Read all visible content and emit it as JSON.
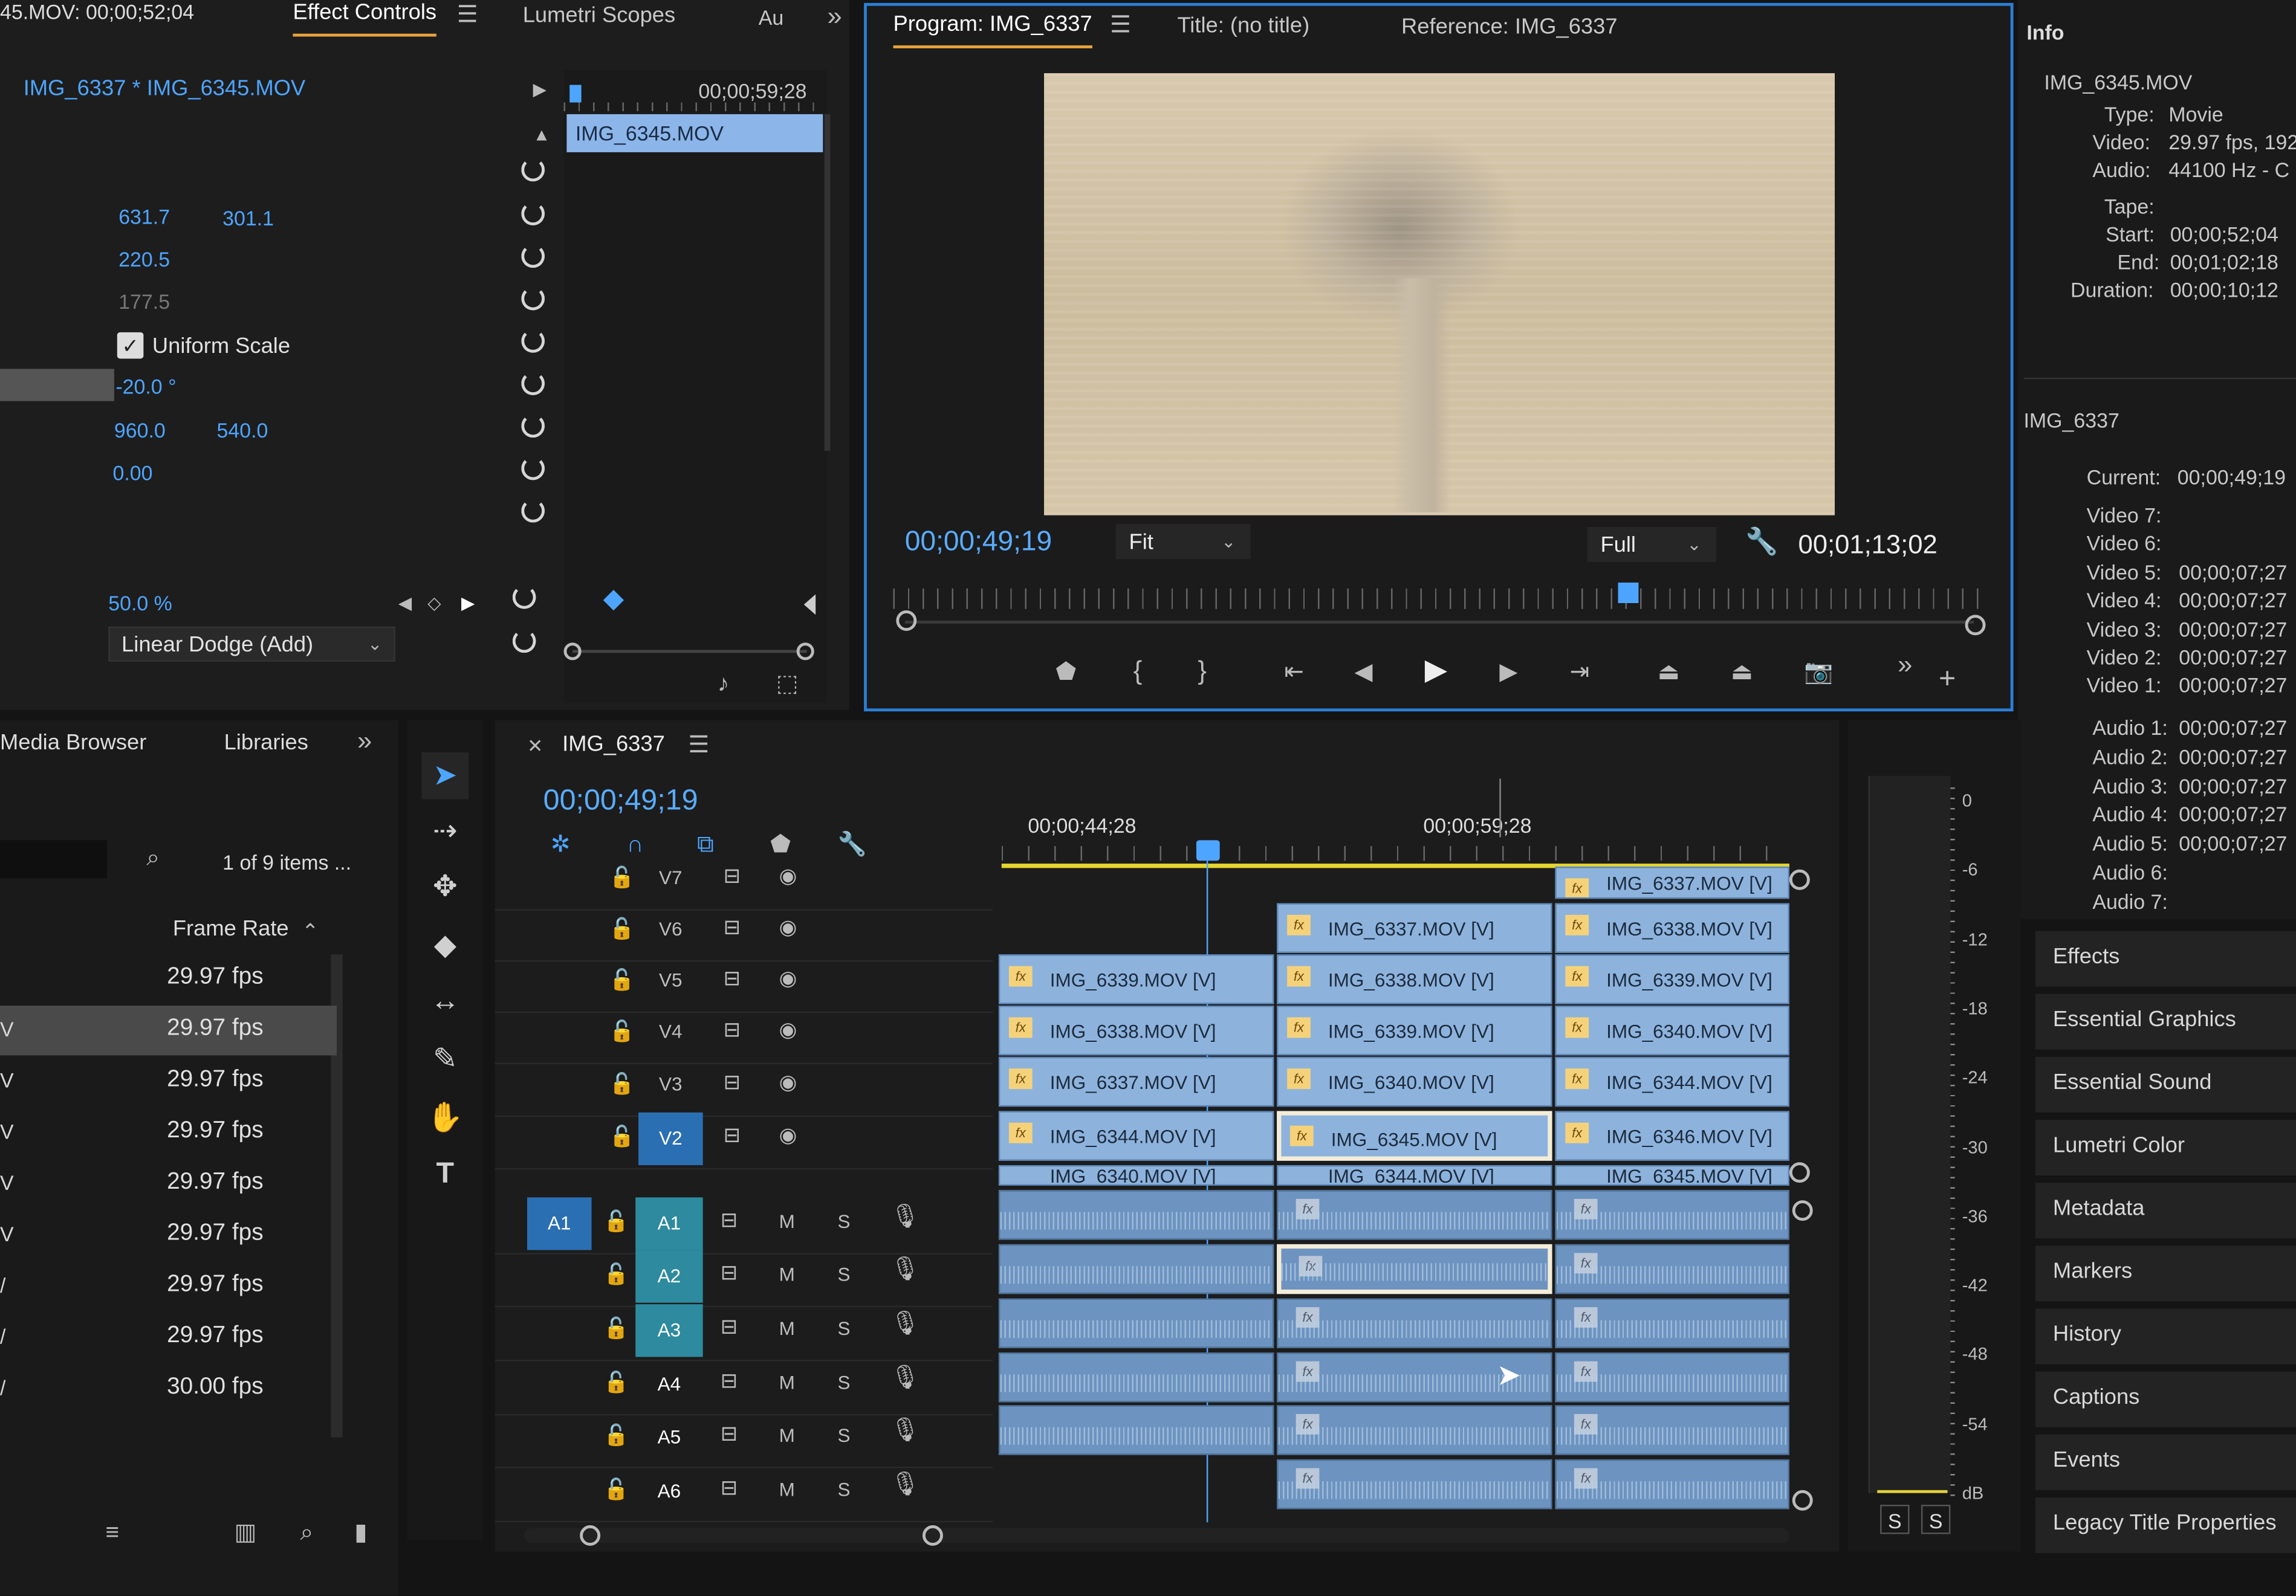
{
  "effect_controls": {
    "header_left": "45.MOV: 00;00;52;04",
    "tab_effect_controls": "Effect Controls",
    "tab_lumetri_scopes": "Lumetri Scopes",
    "tab_audio_short": "Au",
    "clip_breadcrumb": "IMG_6337 * IMG_6345.MOV",
    "timecode_end": "00;00;59;28",
    "mini_clip": "IMG_6345.MOV",
    "position_x": "631.7",
    "position_y": "301.1",
    "scale": "220.5",
    "scale_width": "177.5",
    "uniform_scale_label": "Uniform Scale",
    "rotation": "-20.0 °",
    "anchor_x": "960.0",
    "anchor_y": "540.0",
    "anti_flicker": "0.00",
    "opacity": "50.0 %",
    "blend_mode": "Linear Dodge (Add)"
  },
  "program_monitor": {
    "tab_program": "Program: IMG_6337",
    "tab_title": "Title: (no title)",
    "tab_reference": "Reference: IMG_6337",
    "current_time": "00;00;49;19",
    "fit_select": "Fit",
    "quality_select": "Full",
    "duration": "00;01;13;02"
  },
  "info_panel": {
    "title": "Info",
    "clip_name": "IMG_6345.MOV",
    "type_label": "Type:",
    "type_value": "Movie",
    "video_label": "Video:",
    "video_value": "29.97 fps, 192",
    "audio_label": "Audio:",
    "audio_value": "44100 Hz - C",
    "tape_label": "Tape:",
    "start_label": "Start:",
    "start_value": "00;00;52;04",
    "end_label": "End:",
    "end_value": "00;01;02;18",
    "duration_label": "Duration:",
    "duration_value": "00;00;10;12",
    "sequence_name": "IMG_6337",
    "current_label": "Current:",
    "current_value": "00;00;49;19",
    "video_tracks": [
      {
        "label": "Video 7:",
        "value": ""
      },
      {
        "label": "Video 6:",
        "value": ""
      },
      {
        "label": "Video 5:",
        "value": "00;00;07;27"
      },
      {
        "label": "Video 4:",
        "value": "00;00;07;27"
      },
      {
        "label": "Video 3:",
        "value": "00;00;07;27"
      },
      {
        "label": "Video 2:",
        "value": "00;00;07;27"
      },
      {
        "label": "Video 1:",
        "value": "00;00;07;27"
      }
    ],
    "audio_tracks": [
      {
        "label": "Audio 1:",
        "value": "00;00;07;27"
      },
      {
        "label": "Audio 2:",
        "value": "00;00;07;27"
      },
      {
        "label": "Audio 3:",
        "value": "00;00;07;27"
      },
      {
        "label": "Audio 4:",
        "value": "00;00;07;27"
      },
      {
        "label": "Audio 5:",
        "value": "00;00;07;27"
      },
      {
        "label": "Audio 6:",
        "value": ""
      },
      {
        "label": "Audio 7:",
        "value": ""
      }
    ]
  },
  "right_panels": [
    "Effects",
    "Essential Graphics",
    "Essential Sound",
    "Lumetri Color",
    "Metadata",
    "Markers",
    "History",
    "Captions",
    "Events",
    "Legacy Title Properties"
  ],
  "project": {
    "tab_media_browser": "Media Browser",
    "tab_libraries": "Libraries",
    "items_count": "1 of 9 items ...",
    "col_frame_rate": "Frame Rate",
    "rows": [
      {
        "prefix": "",
        "fps": "29.97 fps"
      },
      {
        "prefix": "V",
        "fps": "29.97 fps"
      },
      {
        "prefix": "V",
        "fps": "29.97 fps"
      },
      {
        "prefix": "V",
        "fps": "29.97 fps"
      },
      {
        "prefix": "V",
        "fps": "29.97 fps"
      },
      {
        "prefix": "V",
        "fps": "29.97 fps"
      },
      {
        "prefix": "/",
        "fps": "29.97 fps"
      },
      {
        "prefix": "/",
        "fps": "29.97 fps"
      },
      {
        "prefix": "/",
        "fps": "30.00 fps"
      }
    ]
  },
  "timeline": {
    "sequence_tab": "IMG_6337",
    "current_time": "00;00;49;19",
    "ruler_left": "00;00;44;28",
    "ruler_right": "00;00;59;28",
    "video_tracks": [
      "V7",
      "V6",
      "V5",
      "V4",
      "V3",
      "V2"
    ],
    "audio_tracks": [
      "A1",
      "A2",
      "A3",
      "A4",
      "A5",
      "A6"
    ],
    "source_audio": "A1",
    "mute_label": "M",
    "solo_label": "S",
    "clips": {
      "v7_c": "IMG_6337.MOV [V]",
      "v6_b": "IMG_6337.MOV [V]",
      "v6_c": "IMG_6338.MOV [V]",
      "v5_a": "IMG_6339.MOV [V]",
      "v5_b": "IMG_6338.MOV [V]",
      "v5_c": "IMG_6339.MOV [V]",
      "v4_a": "IMG_6338.MOV [V]",
      "v4_b": "IMG_6339.MOV [V]",
      "v4_c": "IMG_6340.MOV [V]",
      "v3_a": "IMG_6337.MOV [V]",
      "v3_b": "IMG_6340.MOV [V]",
      "v3_c": "IMG_6344.MOV [V]",
      "v2_a": "IMG_6344.MOV [V]",
      "v2_b": "IMG_6345.MOV [V]",
      "v2_c": "IMG_6346.MOV [V]",
      "v1_a": "IMG_6340.MOV [V]",
      "v1_b": "IMG_6344.MOV [V]",
      "v1_c": "IMG_6345.MOV [V]"
    }
  },
  "audio_meter": {
    "scale": [
      "0",
      "-6",
      "-12",
      "-18",
      "-24",
      "-30",
      "-36",
      "-42",
      "-48",
      "-54",
      "dB"
    ],
    "solo_left": "S",
    "solo_right": "S"
  },
  "icons": [
    "hamburger-icon",
    "chevron-right-icon",
    "reset-icon",
    "checkbox-checked-icon",
    "selection-tool-icon",
    "track-select-icon",
    "ripple-edit-icon",
    "razor-icon",
    "slip-icon",
    "pen-icon",
    "hand-icon",
    "type-icon",
    "play-icon",
    "step-back-icon",
    "step-forward-icon",
    "marker-icon",
    "wrench-icon",
    "camera-icon",
    "lock-icon",
    "eye-icon",
    "mic-icon",
    "magnet-icon",
    "search-icon"
  ]
}
